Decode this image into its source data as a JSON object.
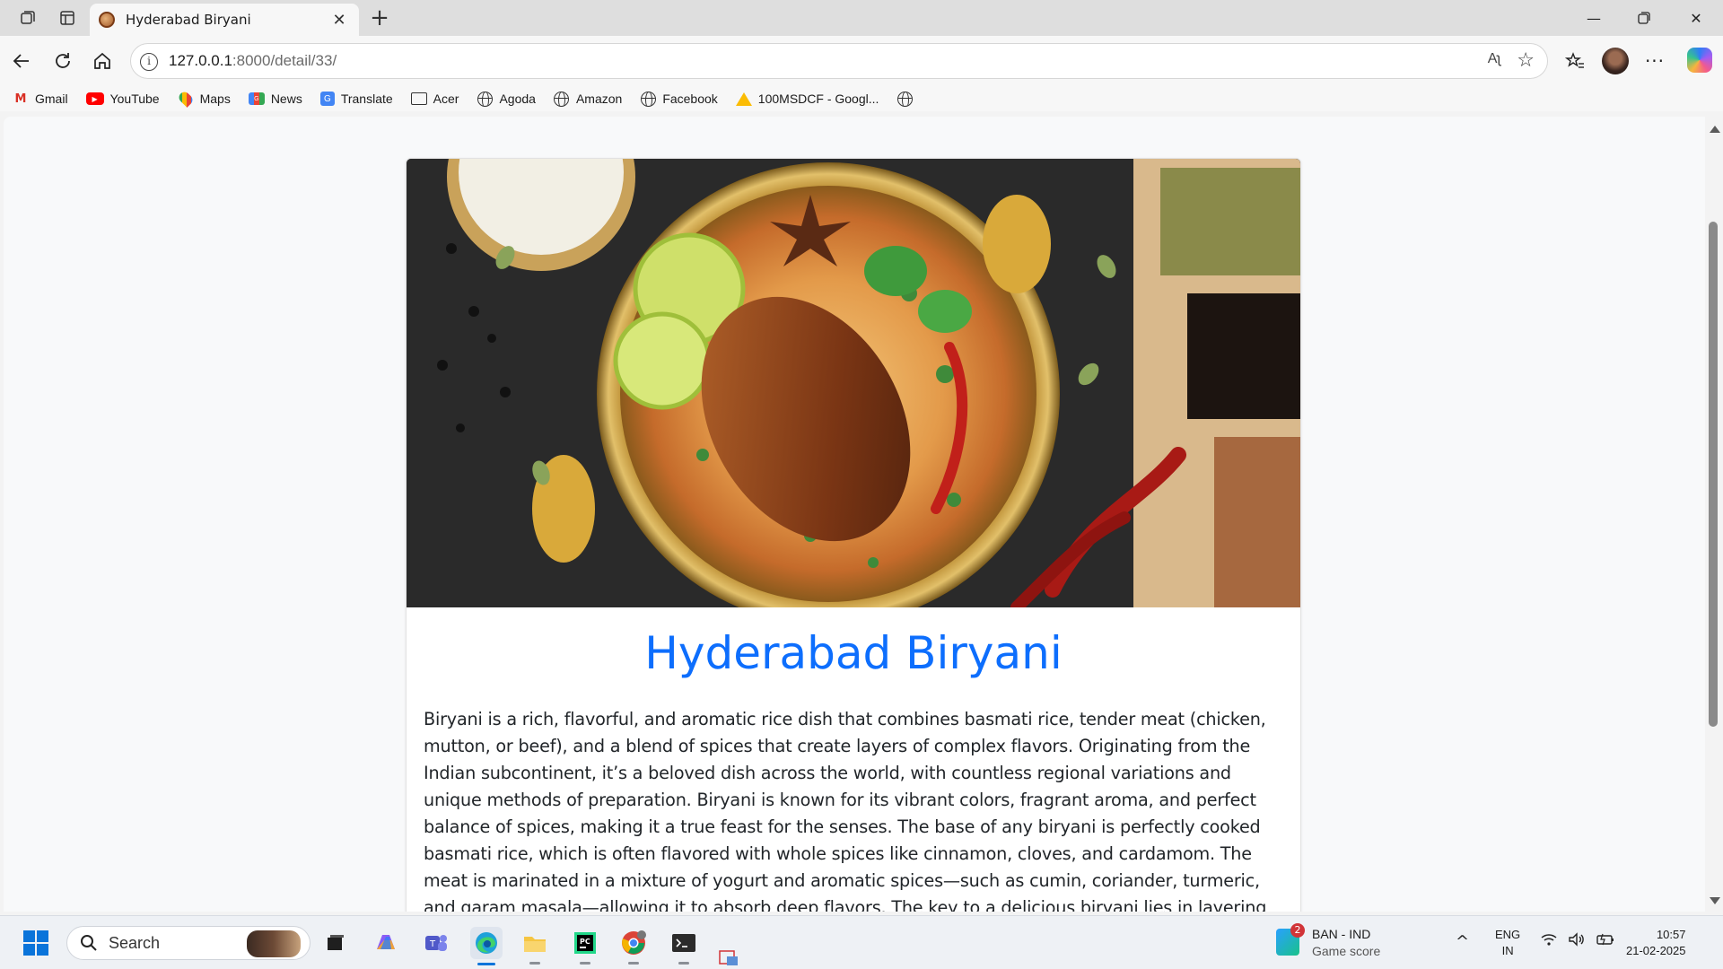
{
  "browser": {
    "tab": {
      "title": "Hyderabad Biryani"
    },
    "address": {
      "host": "127.0.0.1",
      "path": ":8000/detail/33/"
    },
    "read_aloud": "Aʅ",
    "bookmarks": [
      {
        "label": "Gmail",
        "icon": "gmail-icon"
      },
      {
        "label": "YouTube",
        "icon": "youtube-icon"
      },
      {
        "label": "Maps",
        "icon": "maps-icon"
      },
      {
        "label": "News",
        "icon": "news-icon"
      },
      {
        "label": "Translate",
        "icon": "translate-icon"
      },
      {
        "label": "Acer",
        "icon": "folder-icon"
      },
      {
        "label": "Agoda",
        "icon": "globe-icon"
      },
      {
        "label": "Amazon",
        "icon": "globe-icon"
      },
      {
        "label": "Facebook",
        "icon": "globe-icon"
      },
      {
        "label": "100MSDCF - Googl...",
        "icon": "drive-icon"
      }
    ]
  },
  "page": {
    "title": "Hyderabad Biryani",
    "title_color": "#0d6efd",
    "description": "Biryani is a rich, flavorful, and aromatic rice dish that combines basmati rice, tender meat (chicken, mutton, or beef), and a blend of spices that create layers of complex flavors. Originating from the Indian subcontinent, it’s a beloved dish across the world, with countless regional variations and unique methods of preparation. Biryani is known for its vibrant colors, fragrant aroma, and perfect balance of spices, making it a true feast for the senses. The base of any biryani is perfectly cooked basmati rice, which is often flavored with whole spices like cinnamon, cloves, and cardamom. The meat is marinated in a mixture of yogurt and aromatic spices—such as cumin, coriander, turmeric, and garam masala—allowing it to absorb deep flavors. The key to a delicious biryani lies in layering the rice and meat. The marinated meat is cooked separately and"
  },
  "taskbar": {
    "search_label": "Search",
    "widget": {
      "badge": "2",
      "line1": "BAN - IND",
      "line2": "Game score"
    },
    "lang": {
      "line1": "ENG",
      "line2": "IN"
    },
    "clock": {
      "time": "10:57",
      "date": "21-02-2025"
    }
  }
}
